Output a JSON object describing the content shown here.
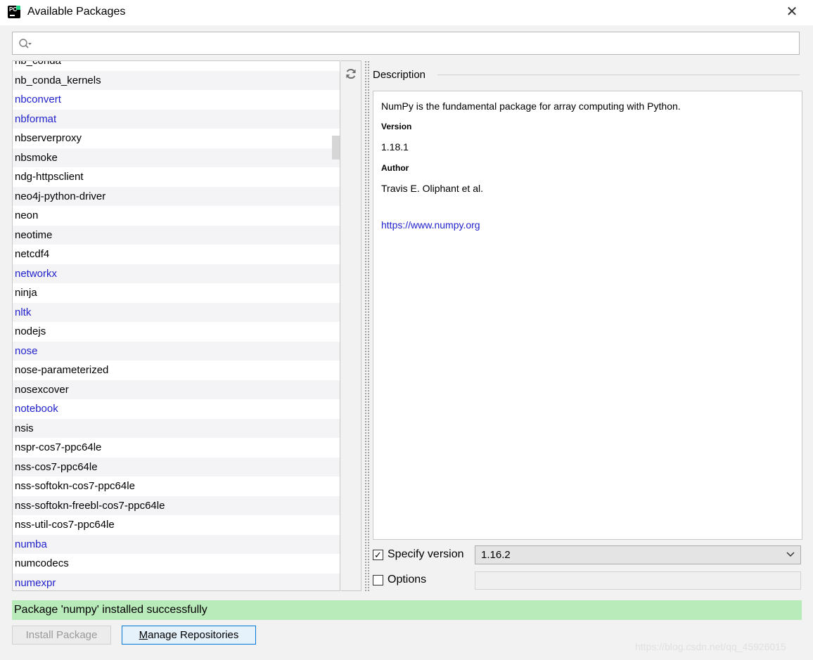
{
  "window": {
    "title": "Available Packages",
    "close_glyph": "✕"
  },
  "app_icon": {
    "text": "PC"
  },
  "search": {
    "placeholder": ""
  },
  "packages": [
    {
      "name": "nb_conda",
      "link": false
    },
    {
      "name": "nb_conda_kernels",
      "link": false
    },
    {
      "name": "nbconvert",
      "link": true
    },
    {
      "name": "nbformat",
      "link": true
    },
    {
      "name": "nbserverproxy",
      "link": false
    },
    {
      "name": "nbsmoke",
      "link": false
    },
    {
      "name": "ndg-httpsclient",
      "link": false
    },
    {
      "name": "neo4j-python-driver",
      "link": false
    },
    {
      "name": "neon",
      "link": false
    },
    {
      "name": "neotime",
      "link": false
    },
    {
      "name": "netcdf4",
      "link": false
    },
    {
      "name": "networkx",
      "link": true
    },
    {
      "name": "ninja",
      "link": false
    },
    {
      "name": "nltk",
      "link": true
    },
    {
      "name": "nodejs",
      "link": false
    },
    {
      "name": "nose",
      "link": true
    },
    {
      "name": "nose-parameterized",
      "link": false
    },
    {
      "name": "nosexcover",
      "link": false
    },
    {
      "name": "notebook",
      "link": true
    },
    {
      "name": "nsis",
      "link": false
    },
    {
      "name": "nspr-cos7-ppc64le",
      "link": false
    },
    {
      "name": "nss-cos7-ppc64le",
      "link": false
    },
    {
      "name": "nss-softokn-cos7-ppc64le",
      "link": false
    },
    {
      "name": "nss-softokn-freebl-cos7-ppc64le",
      "link": false
    },
    {
      "name": "nss-util-cos7-ppc64le",
      "link": false
    },
    {
      "name": "numba",
      "link": true
    },
    {
      "name": "numcodecs",
      "link": false
    },
    {
      "name": "numexpr",
      "link": true
    }
  ],
  "description": {
    "header": "Description",
    "summary": "NumPy is the fundamental package for array computing with Python.",
    "version_label": "Version",
    "version": "1.18.1",
    "author_label": "Author",
    "author": "Travis E. Oliphant et al.",
    "url": "https://www.numpy.org"
  },
  "specify_version": {
    "label": "Specify version",
    "checked": true,
    "check_glyph": "✓",
    "value": "1.16.2"
  },
  "options": {
    "label": "Options",
    "checked": false,
    "value": ""
  },
  "status": {
    "message": "Package 'numpy' installed successfully",
    "color": "#b9eab9"
  },
  "buttons": {
    "install_label": "Install Package",
    "manage_mnemonic": "M",
    "manage_rest": "anage Repositories"
  },
  "watermark": "https://blog.csdn.net/qq_45926015",
  "colors": {
    "link": "#2222cc",
    "focus_border": "#0078d7",
    "app_icon_accent": "#21d789"
  }
}
